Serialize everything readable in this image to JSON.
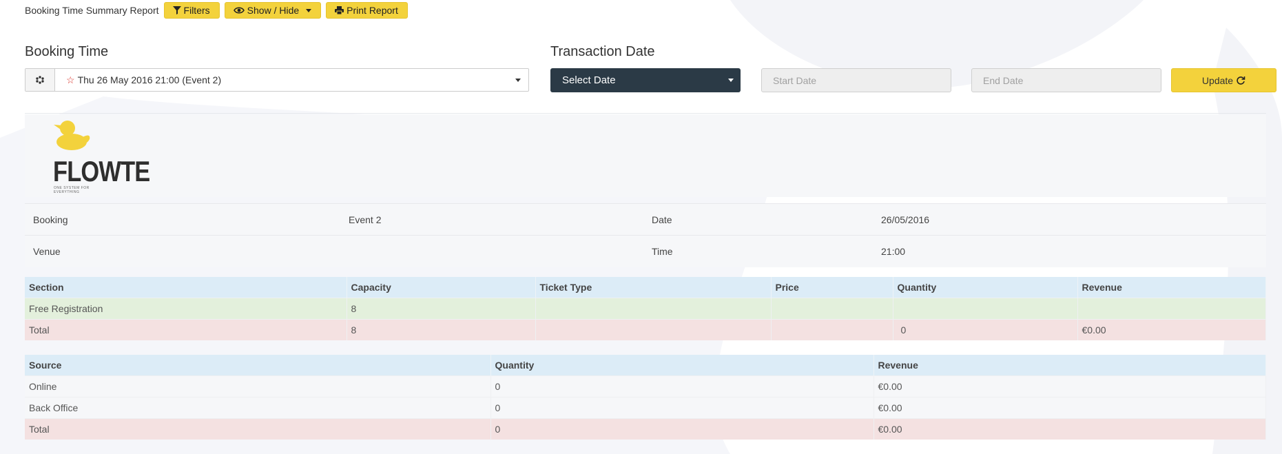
{
  "toolbar": {
    "title": "Booking Time Summary Report",
    "filters_label": "Filters",
    "show_hide_label": "Show / Hide",
    "print_label": "Print Report"
  },
  "filters": {
    "booking_time_label": "Booking Time",
    "booking_time_value": "Thu 26 May 2016 21:00 (Event 2)",
    "transaction_date_label": "Transaction Date",
    "select_date_label": "Select Date",
    "start_date_placeholder": "Start Date",
    "end_date_placeholder": "End Date",
    "update_label": "Update"
  },
  "logo": {
    "name": "FLOWTE",
    "tagline": "ONE SYSTEM FOR EVERYTHING"
  },
  "info": [
    {
      "label1": "Booking",
      "value1": "Event 2",
      "label2": "Date",
      "value2": "26/05/2016"
    },
    {
      "label1": "Venue",
      "value1": "",
      "label2": "Time",
      "value2": "21:00"
    }
  ],
  "section_table": {
    "headers": [
      "Section",
      "Capacity",
      "Ticket Type",
      "Price",
      "Quantity",
      "Revenue"
    ],
    "rows": [
      [
        "Free Registration",
        "8",
        "",
        "",
        "",
        ""
      ],
      [
        "Total",
        "8",
        "",
        "",
        "0",
        "€0.00"
      ]
    ]
  },
  "source_table": {
    "headers": [
      "Source",
      "Quantity",
      "Revenue"
    ],
    "rows": [
      [
        "Online",
        "0",
        "€0.00"
      ],
      [
        "Back Office",
        "0",
        "€0.00"
      ],
      [
        "Total",
        "0",
        "€0.00"
      ]
    ]
  },
  "colors": {
    "accent_yellow": "#f3d23c",
    "dark_select": "#2b3a46",
    "header_blue": "#dcecf7",
    "row_green": "#e3f0dc",
    "row_red": "#f4e1e1"
  }
}
